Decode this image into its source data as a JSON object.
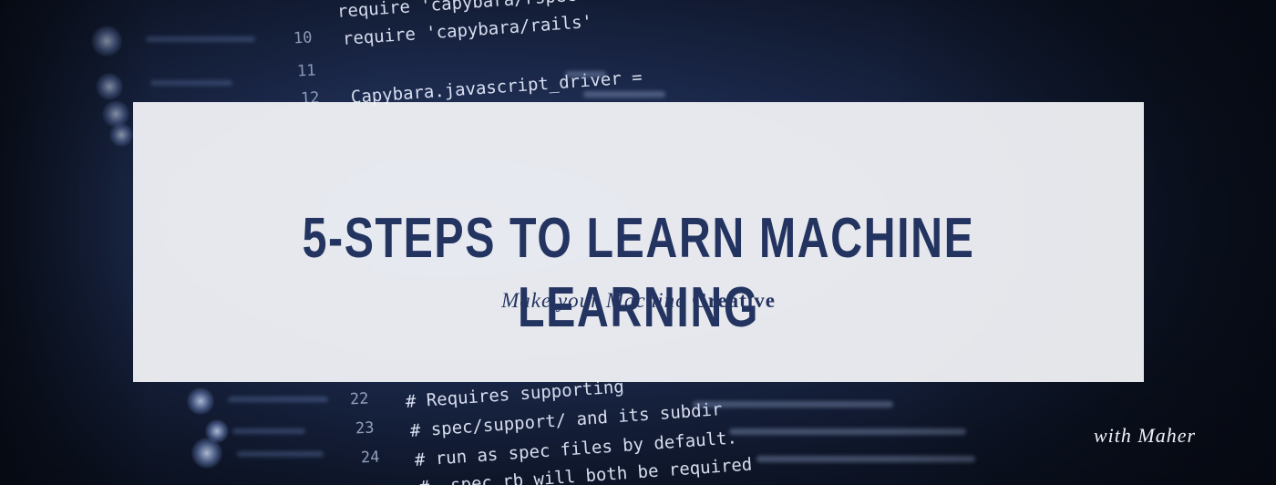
{
  "banner": {
    "title": "5-STEPS TO LEARN MACHINE LEARNING",
    "subtitle_italic": "Make your Machine",
    "subtitle_bold": "Creative",
    "byline": "with Maher"
  },
  "background_code": {
    "gutter_numbers": [
      "10",
      "11",
      "12",
      "22",
      "23",
      "24"
    ],
    "lines": [
      "require 'capybara/rspec'",
      "require 'capybara/rails'",
      "Capybara.javascript_driver =",
      "# Requires supporting",
      "# spec/support/ and its subdir",
      "# run as spec files by default.",
      "# _spec.rb will both be required"
    ]
  },
  "colors": {
    "title": "#243461",
    "card": "#f5f6fa",
    "background": "#1a2748",
    "byline": "#eef1f8"
  }
}
